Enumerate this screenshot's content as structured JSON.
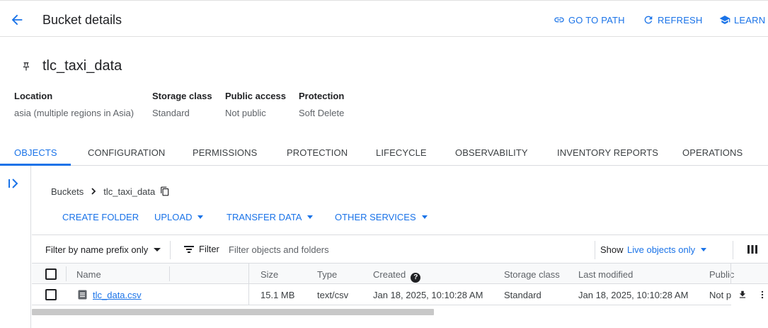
{
  "header": {
    "title": "Bucket details",
    "actions": {
      "go_to_path": "GO TO PATH",
      "refresh": "REFRESH",
      "learn": "LEARN"
    }
  },
  "bucket": {
    "name": "tlc_taxi_data",
    "meta": {
      "location_label": "Location",
      "location_value": "asia (multiple regions in Asia)",
      "storage_class_label": "Storage class",
      "storage_class_value": "Standard",
      "public_access_label": "Public access",
      "public_access_value": "Not public",
      "protection_label": "Protection",
      "protection_value": "Soft Delete"
    }
  },
  "tabs": [
    {
      "label": "OBJECTS",
      "active": true
    },
    {
      "label": "CONFIGURATION"
    },
    {
      "label": "PERMISSIONS"
    },
    {
      "label": "PROTECTION"
    },
    {
      "label": "LIFECYCLE"
    },
    {
      "label": "OBSERVABILITY"
    },
    {
      "label": "INVENTORY REPORTS"
    },
    {
      "label": "OPERATIONS"
    }
  ],
  "breadcrumb": {
    "root": "Buckets",
    "current": "tlc_taxi_data"
  },
  "object_actions": {
    "create_folder": "CREATE FOLDER",
    "upload": "UPLOAD",
    "transfer_data": "TRANSFER DATA",
    "other_services": "OTHER SERVICES"
  },
  "filter": {
    "mode": "Filter by name prefix only",
    "label": "Filter",
    "placeholder": "Filter objects and folders",
    "show_label": "Show",
    "show_value": "Live objects only"
  },
  "table": {
    "columns": {
      "name": "Name",
      "size": "Size",
      "type": "Type",
      "created": "Created",
      "storage_class": "Storage class",
      "last_modified": "Last modified",
      "public": "Public"
    },
    "rows": [
      {
        "name": "tlc_data.csv",
        "size": "15.1 MB",
        "type": "text/csv",
        "created": "Jan 18, 2025, 10:10:28 AM",
        "storage_class": "Standard",
        "last_modified": "Jan 18, 2025, 10:10:28 AM",
        "public": "Not p"
      }
    ]
  },
  "colors": {
    "accent": "#1a73e8",
    "text": "#202124",
    "muted": "#5f6368",
    "border": "#dadce0"
  }
}
